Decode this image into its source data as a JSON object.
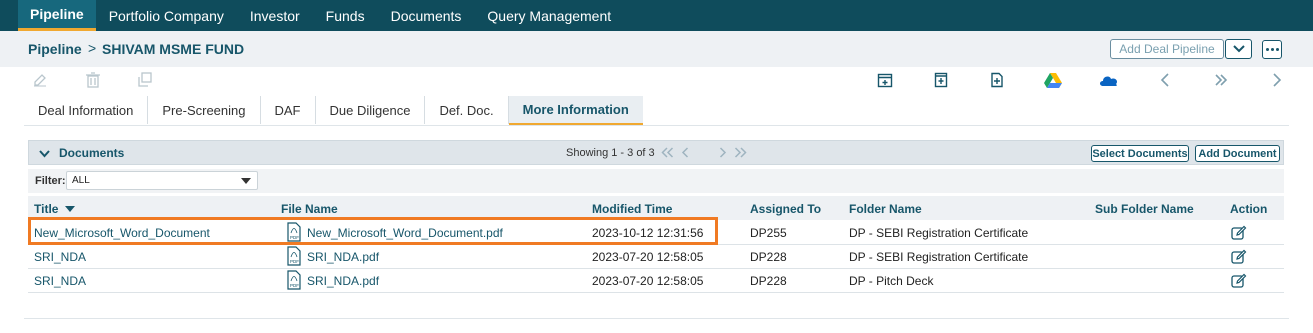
{
  "nav": {
    "items": [
      "Pipeline",
      "Portfolio Company",
      "Investor",
      "Funds",
      "Documents",
      "Query Management"
    ],
    "active": "Pipeline"
  },
  "breadcrumb": {
    "root": "Pipeline",
    "separator": ">",
    "current": "SHIVAM MSME FUND"
  },
  "header_actions": {
    "add_deal_label": "Add Deal Pipeline"
  },
  "toolbar": {
    "left_icons": [
      "edit-icon",
      "delete-icon",
      "copy-icon"
    ],
    "right_icons": [
      "calendar-add-icon",
      "document-export-icon",
      "file-add-icon",
      "google-drive-icon",
      "onedrive-icon",
      "chevron-left-icon",
      "double-chevron-right-icon",
      "chevron-right-icon"
    ]
  },
  "tabs": [
    {
      "label": "Deal Information"
    },
    {
      "label": "Pre-Screening"
    },
    {
      "label": "DAF"
    },
    {
      "label": "Due Diligence"
    },
    {
      "label": "Def. Doc."
    },
    {
      "label": "More Information",
      "active": true
    }
  ],
  "documents": {
    "title": "Documents",
    "showing": "Showing 1 - 3 of 3",
    "select_documents_label": "Select Documents",
    "add_document_label": "Add Document",
    "filter": {
      "label": "Filter:",
      "value": "ALL"
    },
    "columns": [
      "Title",
      "File Name",
      "Modified Time",
      "Assigned To",
      "Folder Name",
      "Sub Folder Name",
      "Action"
    ],
    "rows": [
      {
        "title": "New_Microsoft_Word_Document",
        "file_name": "New_Microsoft_Word_Document.pdf",
        "modified": "2023-10-12 12:31:56",
        "assigned_to": "DP255",
        "folder": "DP - SEBI Registration Certificate",
        "sub_folder": ""
      },
      {
        "title": "SRI_NDA",
        "file_name": "SRI_NDA.pdf",
        "modified": "2023-07-20 12:58:05",
        "assigned_to": "DP228",
        "folder": "DP - SEBI Registration Certificate",
        "sub_folder": ""
      },
      {
        "title": "SRI_NDA",
        "file_name": "SRI_NDA.pdf",
        "modified": "2023-07-20 12:58:05",
        "assigned_to": "DP228",
        "folder": "DP - Pitch Deck",
        "sub_folder": ""
      }
    ]
  },
  "colors": {
    "nav_bg": "#0f4c5c",
    "accent": "#f0a830",
    "link": "#17566a",
    "highlight": "#f07a23"
  }
}
